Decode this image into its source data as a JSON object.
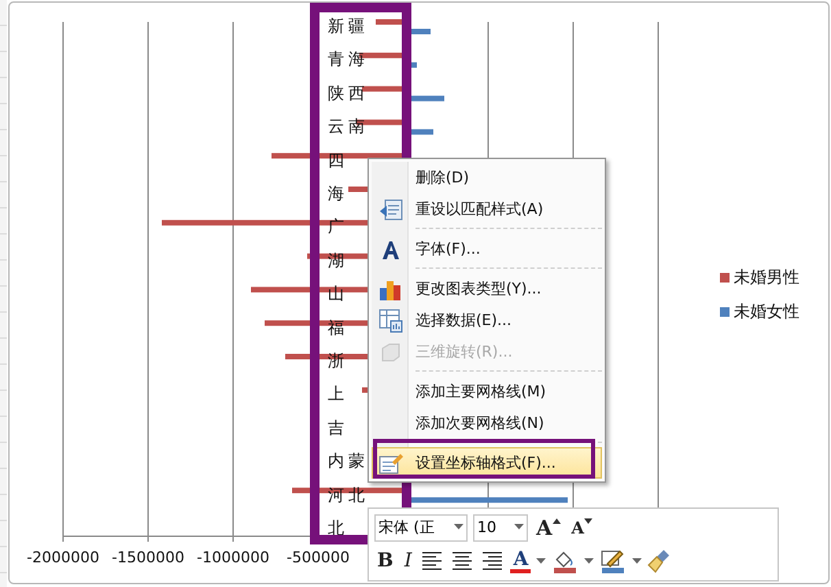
{
  "chart": {
    "categories": [
      "新疆",
      "青海",
      "陕西",
      "云南",
      "四",
      "海",
      "广",
      "湖",
      "山",
      "福",
      "浙",
      "上",
      "吉",
      "内蒙",
      "河北",
      "北"
    ],
    "x_axis_ticks": [
      "-2000000",
      "-1500000",
      "-1000000",
      "-500000"
    ],
    "legend": [
      {
        "label": "未婚男性",
        "color": "#c0504d"
      },
      {
        "label": "未婚女性",
        "color": "#4f81bd"
      }
    ]
  },
  "menu": {
    "groups": [
      {
        "items": [
          {
            "label": "删除(D)",
            "kind": "plain",
            "disabled": false,
            "selected": false
          },
          {
            "label": "重设以匹配样式(A)",
            "kind": "reset",
            "disabled": false,
            "selected": false
          }
        ]
      },
      {
        "items": [
          {
            "label": "字体(F)...",
            "kind": "font",
            "disabled": false,
            "selected": false
          }
        ]
      },
      {
        "items": [
          {
            "label": "更改图表类型(Y)...",
            "kind": "charttype",
            "disabled": false,
            "selected": false
          },
          {
            "label": "选择数据(E)...",
            "kind": "data",
            "disabled": false,
            "selected": false
          },
          {
            "label": "三维旋转(R)...",
            "kind": "rotate",
            "disabled": true,
            "selected": false
          }
        ]
      },
      {
        "items": [
          {
            "label": "添加主要网格线(M)",
            "kind": "plain",
            "disabled": false,
            "selected": false
          },
          {
            "label": "添加次要网格线(N)",
            "kind": "plain",
            "disabled": false,
            "selected": false
          }
        ]
      },
      {
        "items": [
          {
            "label": "设置坐标轴格式(F)...",
            "kind": "format",
            "disabled": false,
            "selected": true
          }
        ]
      }
    ]
  },
  "mini_toolbar": {
    "font_name": "宋体 (正",
    "font_size": "10",
    "grow_font": "A",
    "shrink_font": "A",
    "bold": "B",
    "italic": "I",
    "font_color": "A"
  }
}
